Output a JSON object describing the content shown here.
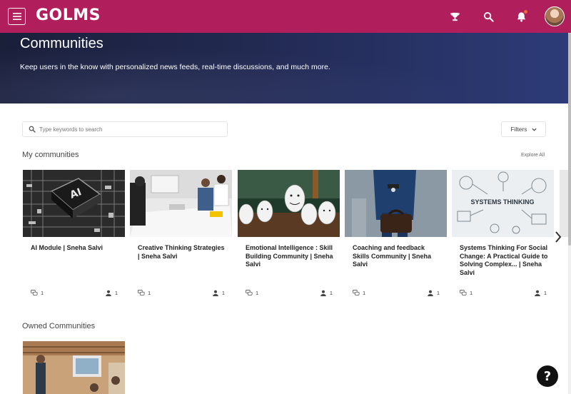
{
  "header": {
    "logo_text": "GOLMS",
    "brand_color": "#b01f5c",
    "icons": [
      "menu-icon",
      "trophy-icon",
      "search-icon",
      "bell-icon",
      "avatar"
    ]
  },
  "hero": {
    "title": "Communities",
    "subtitle": "Keep users in the know with personalized news feeds, real-time discussions, and much more."
  },
  "search": {
    "placeholder": "Type keywords to search",
    "filters_label": "Filters"
  },
  "my_communities": {
    "title": "My communities",
    "explore_label": "Explore All",
    "cards": [
      {
        "title": "AI Module | Sneha Salvi",
        "discussions": "1",
        "members": "1",
        "image": "ai-chip-image"
      },
      {
        "title": "Creative Thinking Strategies | Sneha Salvi",
        "discussions": "1",
        "members": "1",
        "image": "meeting-room-image"
      },
      {
        "title": "Emotional Intelligence : Skill Building Community | Sneha Salvi",
        "discussions": "1",
        "members": "1",
        "image": "egg-faces-image"
      },
      {
        "title": "Coaching and feedback Skills Community | Sneha Salvi",
        "discussions": "1",
        "members": "1",
        "image": "businessman-briefcase-image"
      },
      {
        "title": "Systems Thinking For Social Change: A Practical Guide to Solving Complex... | Sneha Salvi",
        "discussions": "1",
        "members": "1",
        "image": "systems-thinking-image",
        "image_text": "SYSTEMS THINKING"
      }
    ]
  },
  "owned_communities": {
    "title": "Owned Communities"
  },
  "help": {
    "label": "?"
  }
}
